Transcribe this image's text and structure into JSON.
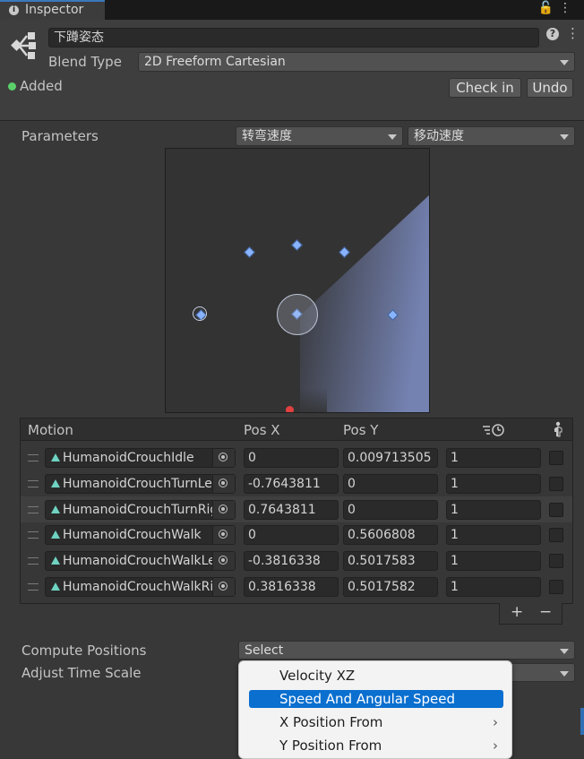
{
  "tab": {
    "title": "Inspector"
  },
  "header": {
    "asset_name": "下蹲姿态",
    "blend_type_label": "Blend Type",
    "blend_type_value": "2D Freeform Cartesian",
    "added_label": "Added",
    "check_in_label": "Check in",
    "undo_label": "Undo"
  },
  "parameters": {
    "label": "Parameters",
    "param_x": "转弯速度",
    "param_y": "移动速度"
  },
  "motion_list": {
    "headers": {
      "motion": "Motion",
      "pos_x": "Pos X",
      "pos_y": "Pos Y"
    },
    "rows": [
      {
        "motion": "HumanoidCrouchIdle",
        "pos_x": "0",
        "pos_y": "0.009713505",
        "speed": "1"
      },
      {
        "motion": "HumanoidCrouchTurnLeft",
        "pos_x": "-0.7643811",
        "pos_y": "0",
        "speed": "1"
      },
      {
        "motion": "HumanoidCrouchTurnRight",
        "pos_x": "0.7643811",
        "pos_y": "0",
        "speed": "1"
      },
      {
        "motion": "HumanoidCrouchWalk",
        "pos_x": "0",
        "pos_y": "0.5606808",
        "speed": "1"
      },
      {
        "motion": "HumanoidCrouchWalkLeft",
        "pos_x": "-0.3816338",
        "pos_y": "0.5017583",
        "speed": "1"
      },
      {
        "motion": "HumanoidCrouchWalkRight",
        "pos_x": "0.3816338",
        "pos_y": "0.5017582",
        "speed": "1"
      }
    ],
    "add_label": "+",
    "remove_label": "−"
  },
  "compute": {
    "label": "Compute Positions",
    "value": "Select",
    "adjust_label": "Adjust Time Scale"
  },
  "menu": {
    "items": [
      {
        "label": "Velocity XZ",
        "selected": false,
        "submenu": false
      },
      {
        "label": "Speed And Angular Speed",
        "selected": true,
        "submenu": false
      },
      {
        "label": "X Position From",
        "selected": false,
        "submenu": true
      },
      {
        "label": "Y Position From",
        "selected": false,
        "submenu": true
      }
    ]
  },
  "colors": {
    "selection": "#0a6fcf",
    "accent_tab": "#3a79bb",
    "added_dot": "#5ad06a",
    "graph_tint": "#8090c8",
    "marker": "#88b4ff"
  }
}
